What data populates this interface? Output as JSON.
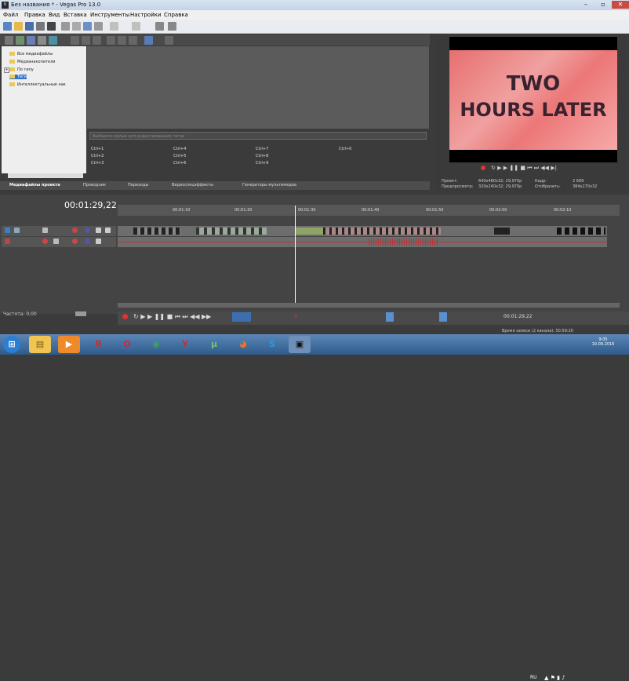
{
  "window": {
    "title": "Без названия * - Vegas Pro 13.0",
    "app_icon": "vegas-icon"
  },
  "menu": [
    "Файл",
    "Правка",
    "Вид",
    "Вставка",
    "Инструменты",
    "Настройки",
    "Справка"
  ],
  "tree": {
    "items": [
      "Все медиафайлы",
      "Медианакопители",
      "По типу",
      "Теги",
      "Интеллектуальные нак"
    ],
    "selected_index": 3
  },
  "tags": {
    "placeholder": "Выберите ярлык для редактирования тегов",
    "shortcuts": [
      "Ctrl+1",
      "Ctrl+4",
      "Ctrl+7",
      "Ctrl+0",
      "Ctrl+2",
      "Ctrl+5",
      "Ctrl+8",
      "Ctrl+3",
      "Ctrl+6",
      "Ctrl+9"
    ]
  },
  "tabs": [
    "Медиафайлы проекта",
    "Проводник",
    "Переходы",
    "Видеоспецэффекты",
    "Генераторы мультимедиа"
  ],
  "preview": {
    "image_text_line1": "TWO",
    "image_text_line2": "HOURS LATER",
    "project_label": "Проект:",
    "project_value": "640x480x32; 29,970p",
    "preview_label": "Предпросмотр:",
    "preview_value": "320x240x32; 29,970p",
    "frame_label": "Кадр:",
    "frame_value": "2 669",
    "display_label": "Отобразить:",
    "display_value": "384x270x32"
  },
  "timeline": {
    "current_time": "00:01:29,22",
    "ruler": [
      "00:01:10",
      "00:01:20",
      "00:01:30",
      "00:01:40",
      "00:01:50",
      "00:02:00",
      "00:02:10"
    ],
    "cursor_time": "00:01:29,22",
    "rate_label": "Частота: 0,00"
  },
  "status": {
    "record_time": "Время записи (2 канала): 50:59:20"
  },
  "taskbar": {
    "apps": [
      {
        "name": "start-button",
        "label": "⊞",
        "color": "#2a7ed3"
      },
      {
        "name": "explorer",
        "label": "▤",
        "color": "#f1c552"
      },
      {
        "name": "media-player",
        "label": "▶",
        "color": "#ef8a2a"
      },
      {
        "name": "yandex",
        "label": "Я",
        "color": "#ffffff"
      },
      {
        "name": "opera",
        "label": "O",
        "color": "#e21d2f"
      },
      {
        "name": "chrome",
        "label": "◉",
        "color": "#3aa657"
      },
      {
        "name": "yandex-browser",
        "label": "Y",
        "color": "#ffffff"
      },
      {
        "name": "utorrent",
        "label": "μ",
        "color": "#79c36a"
      },
      {
        "name": "firefox",
        "label": "◕",
        "color": "#e8722b"
      },
      {
        "name": "skype",
        "label": "S",
        "color": "#1ea0e2"
      },
      {
        "name": "vegas",
        "label": "▣",
        "color": "#222222"
      }
    ],
    "lang": "RU",
    "clock_time": "9:05",
    "clock_date": "10.09.2016"
  }
}
